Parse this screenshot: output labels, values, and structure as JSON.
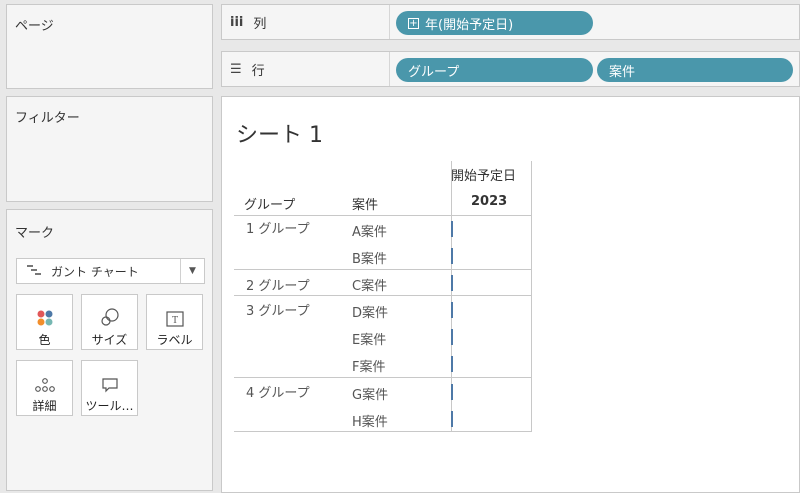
{
  "left": {
    "pages_title": "ページ",
    "filters_title": "フィルター",
    "marks_title": "マーク",
    "mark_type": "ガント チャート",
    "mark_buttons": {
      "color": "色",
      "size": "サイズ",
      "label": "ラベル",
      "detail": "詳細",
      "tooltip": "ツール…"
    }
  },
  "shelves": {
    "columns_label": "列",
    "rows_label": "行",
    "column_pills": [
      "年(開始予定日)"
    ],
    "row_pills": [
      "グループ",
      "案件"
    ],
    "pill_color": "#4a97ab"
  },
  "sheet": {
    "title": "シート 1",
    "header_group": "グループ",
    "header_case": "案件",
    "header_field": "開始予定日",
    "header_year": "2023",
    "groups": [
      {
        "name": "1 グループ",
        "cases": [
          "A案件",
          "B案件"
        ]
      },
      {
        "name": "2 グループ",
        "cases": [
          "C案件"
        ]
      },
      {
        "name": "3 グループ",
        "cases": [
          "D案件",
          "E案件",
          "F案件"
        ]
      },
      {
        "name": "4 グループ",
        "cases": [
          "G案件",
          "H案件"
        ]
      }
    ],
    "gantt_color": "#4e79a7"
  }
}
